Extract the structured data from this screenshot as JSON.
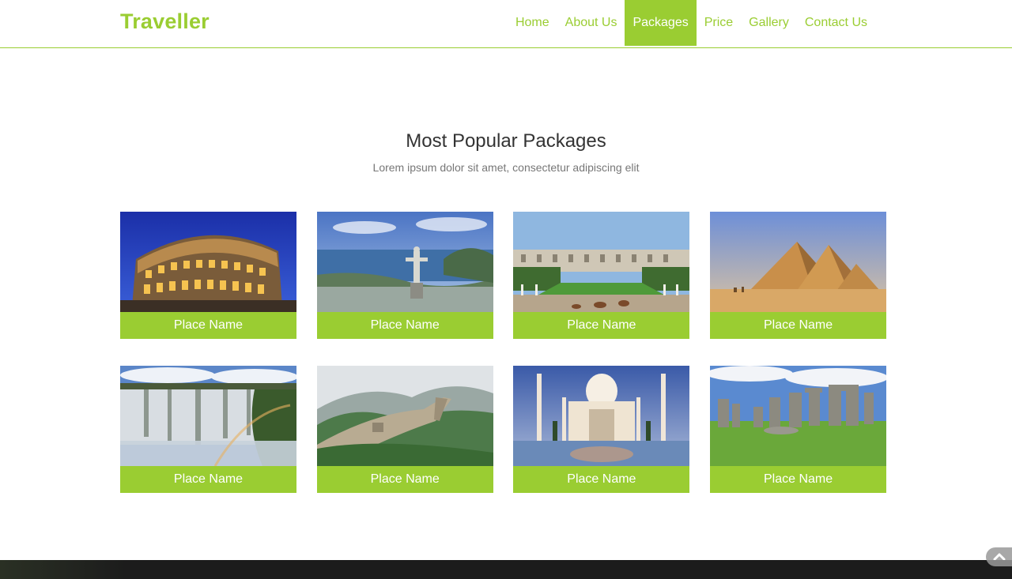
{
  "brand": "Traveller",
  "nav": [
    {
      "label": "Home",
      "active": false
    },
    {
      "label": "About Us",
      "active": false
    },
    {
      "label": "Packages",
      "active": true
    },
    {
      "label": "Price",
      "active": false
    },
    {
      "label": "Gallery",
      "active": false
    },
    {
      "label": "Contact Us",
      "active": false
    }
  ],
  "section": {
    "title": "Most Popular Packages",
    "subtitle": "Lorem ipsum dolor sit amet, consectetur adipiscing elit"
  },
  "packages": [
    {
      "label": "Place Name",
      "image": "colosseum"
    },
    {
      "label": "Place Name",
      "image": "christ-the-redeemer"
    },
    {
      "label": "Place Name",
      "image": "palace-garden"
    },
    {
      "label": "Place Name",
      "image": "pyramids"
    },
    {
      "label": "Place Name",
      "image": "waterfall"
    },
    {
      "label": "Place Name",
      "image": "great-wall"
    },
    {
      "label": "Place Name",
      "image": "taj-mahal"
    },
    {
      "label": "Place Name",
      "image": "stonehenge"
    }
  ],
  "colors": {
    "accent": "#9acd32",
    "title": "#333333",
    "subtitle": "#777777",
    "footer": "#1c1c1c"
  },
  "icons": {
    "scroll_top": "chevron-up-icon"
  }
}
